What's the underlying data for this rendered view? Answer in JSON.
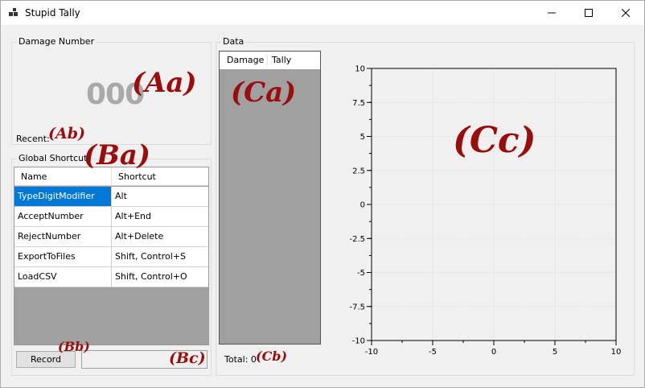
{
  "window": {
    "title": "Stupid Tally"
  },
  "damage_group": {
    "legend": "Damage Number",
    "value": "000",
    "recent_label": "Recent:"
  },
  "shortcut_group": {
    "legend": "Global Shortcut",
    "columns": [
      "Name",
      "Shortcut"
    ],
    "rows": [
      {
        "name": "TypeDigitModifier",
        "shortcut": "Alt"
      },
      {
        "name": "AcceptNumber",
        "shortcut": "Alt+End"
      },
      {
        "name": "RejectNumber",
        "shortcut": "Alt+Delete"
      },
      {
        "name": "ExportToFiles",
        "shortcut": "Shift, Control+S"
      },
      {
        "name": "LoadCSV",
        "shortcut": "Shift, Control+O"
      }
    ],
    "selected_row": 0,
    "record_label": "Record"
  },
  "data_group": {
    "legend": "Data",
    "columns": [
      "Damage",
      "Tally"
    ],
    "total_label": "Total: 0"
  },
  "annotations": {
    "aa": "(Aa)",
    "ab": "(Ab)",
    "ba": "(Ba)",
    "bb": "(Bb)",
    "bc": "(Bc)",
    "ca": "(Ca)",
    "cb": "(Cb)",
    "cc": "(Cc)"
  },
  "chart_data": {
    "type": "scatter",
    "series": [],
    "xlim": [
      -10,
      10
    ],
    "ylim": [
      -10,
      10
    ],
    "x_ticks": [
      -10,
      -5,
      0,
      5,
      10
    ],
    "y_ticks": [
      10,
      7.5,
      5,
      2.5,
      0,
      -2.5,
      -5,
      -7.5,
      -10
    ],
    "y_tick_labels": [
      "10",
      "7.5",
      "5",
      "2.5",
      "0",
      "-2.5",
      "-5",
      "-7.5",
      "-10"
    ],
    "x_tick_labels": [
      "-10",
      "-5",
      "0",
      "5",
      "10"
    ],
    "grid": true
  },
  "colors": {
    "selection": "#0078d7",
    "annotation": "#9b0d0d",
    "big_number": "#a9a9a9"
  }
}
